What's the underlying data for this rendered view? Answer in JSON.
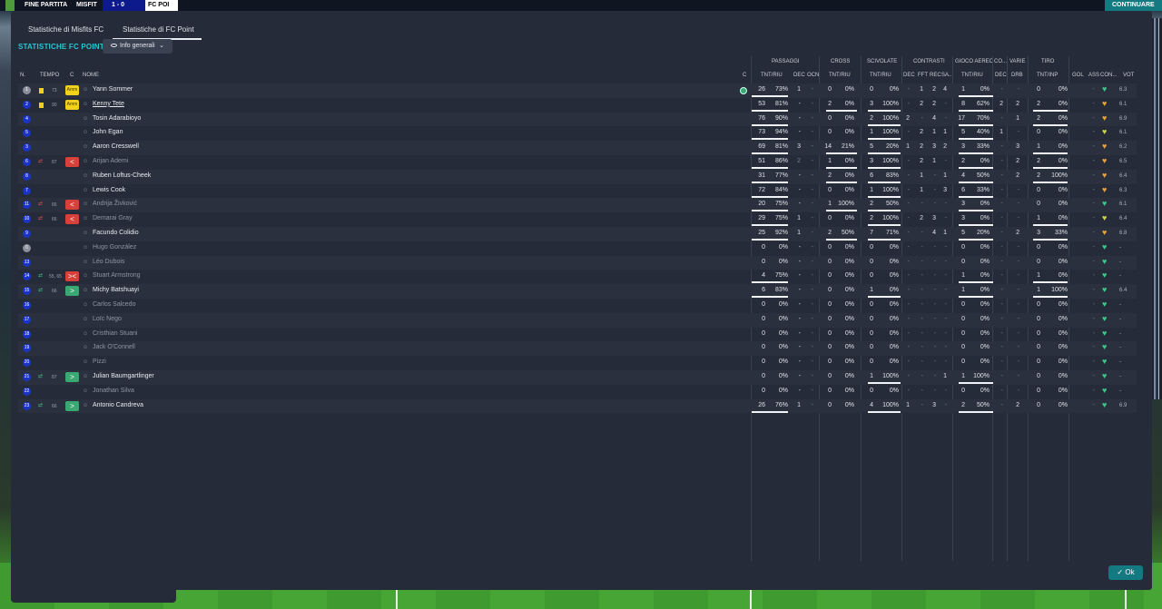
{
  "topbar": {
    "left_label": "FINE PARTITA",
    "home": "MISFIT",
    "away": "FC POI",
    "score": "1 - 0",
    "continue": "CONTINUARE"
  },
  "tabs": [
    {
      "label": "Statistiche di Misfits FC"
    },
    {
      "label": "Statistiche di FC Point"
    }
  ],
  "section_title": "STATISTICHE FC POINT",
  "view_select": {
    "value": "Info generali"
  },
  "groups": {
    "passaggi": "PASSAGGI",
    "cross": "CROSS",
    "scivolate": "SCIVOLATE",
    "contrasti": "CONTRASTI",
    "gioco_aereo": "GIOCO AEREO",
    "co": "CO...",
    "varie": "VARIE",
    "tiro": "TIRO"
  },
  "columns": {
    "n": "N.",
    "tempo": "TEMPO",
    "c": "C",
    "nome": "NOME",
    "c2": "C",
    "tnt_riu": "TNT/RIU",
    "dec": "DEC",
    "ocn": "OCN",
    "tnt_riu2": "TNT/RIU",
    "tnt_riu3": "TNT/RIU",
    "dec2": "DEC",
    "fft": "FFT",
    "rec": "REC",
    "sa": "SA...",
    "tnt_riu4": "TNT/RIU",
    "dec3": "DEC",
    "drb": "DRB",
    "tnt_inp": "TNT/INP",
    "gol": "GOL",
    "ass": "ASS",
    "con": "CON...",
    "vot": "VOT"
  },
  "players": [
    {
      "n": "1",
      "gk": true,
      "card": true,
      "time": "73",
      "c": "amm",
      "name": "Yann Sommer",
      "check": true,
      "pa": "26",
      "pp": "73%",
      "pdec": "1",
      "pocn": "-",
      "ca": "0",
      "cp": "0%",
      "sa": "0",
      "sp": "0%",
      "cd": "-",
      "cf": "1",
      "cr": "2",
      "cs": "4",
      "ga": "1",
      "gp": "0%",
      "co": "-",
      "vd": "-",
      "ta": "0",
      "tp": "0%",
      "gol": "",
      "ass": "-",
      "heart": "g",
      "vot": "6.3"
    },
    {
      "n": "2",
      "card": true,
      "time": "90",
      "c": "amm",
      "name": "Kenny Tete",
      "link": true,
      "pa": "53",
      "pp": "81%",
      "pdec": "-",
      "pocn": "-",
      "ca": "2",
      "cp": "0%",
      "sa": "3",
      "sp": "100%",
      "cd": "-",
      "cf": "2",
      "cr": "2",
      "cs": "-",
      "ga": "8",
      "gp": "62%",
      "co": "2",
      "vd": "2",
      "ta": "2",
      "tp": "0%",
      "gol": "",
      "ass": "-",
      "heart": "o",
      "vot": "6.1"
    },
    {
      "n": "4",
      "name": "Tosin Adarabioyo",
      "pa": "76",
      "pp": "90%",
      "pdec": "-",
      "pocn": "-",
      "ca": "0",
      "cp": "0%",
      "sa": "2",
      "sp": "100%",
      "cd": "2",
      "cf": "-",
      "cr": "4",
      "cs": "-",
      "ga": "17",
      "gp": "70%",
      "co": "-",
      "vd": "1",
      "ta": "2",
      "tp": "0%",
      "gol": "",
      "ass": "-",
      "heart": "o",
      "vot": "6.9"
    },
    {
      "n": "5",
      "name": "John Egan",
      "pa": "73",
      "pp": "94%",
      "pdec": "-",
      "pocn": "-",
      "ca": "0",
      "cp": "0%",
      "sa": "1",
      "sp": "100%",
      "cd": "-",
      "cf": "2",
      "cr": "1",
      "cs": "1",
      "ga": "5",
      "gp": "40%",
      "co": "1",
      "vd": "-",
      "ta": "0",
      "tp": "0%",
      "gol": "",
      "ass": "-",
      "heart": "y",
      "vot": "6.1"
    },
    {
      "n": "3",
      "name": "Aaron Cresswell",
      "pa": "69",
      "pp": "81%",
      "pdec": "3",
      "pocn": "-",
      "ca": "14",
      "cp": "21%",
      "sa": "5",
      "sp": "20%",
      "cd": "1",
      "cf": "2",
      "cr": "3",
      "cs": "2",
      "ga": "3",
      "gp": "33%",
      "co": "-",
      "vd": "3",
      "ta": "1",
      "tp": "0%",
      "gol": "",
      "ass": "-",
      "heart": "o",
      "vot": "6.2"
    },
    {
      "n": "6",
      "sub": "out",
      "time": "87",
      "c": "out",
      "name": "Arijan Ademi",
      "dim": true,
      "pa": "51",
      "pp": "86%",
      "pdec": "2",
      "pocn": "-",
      "ca": "1",
      "cp": "0%",
      "sa": "3",
      "sp": "100%",
      "cd": "-",
      "cf": "2",
      "cr": "1",
      "cs": "-",
      "ga": "2",
      "gp": "0%",
      "co": "-",
      "vd": "2",
      "ta": "2",
      "tp": "0%",
      "gol": "",
      "ass": "-",
      "heart": "o",
      "vot": "6.5"
    },
    {
      "n": "8",
      "name": "Ruben Loftus-Cheek",
      "pa": "31",
      "pp": "77%",
      "pdec": "-",
      "pocn": "-",
      "ca": "2",
      "cp": "0%",
      "sa": "6",
      "sp": "83%",
      "cd": "-",
      "cf": "1",
      "cr": "-",
      "cs": "1",
      "ga": "4",
      "gp": "50%",
      "co": "-",
      "vd": "2",
      "ta": "2",
      "tp": "100%",
      "gol": "",
      "ass": "-",
      "heart": "o",
      "vot": "6.4"
    },
    {
      "n": "7",
      "name": "Lewis Cook",
      "pa": "72",
      "pp": "84%",
      "pdec": "-",
      "pocn": "-",
      "ca": "0",
      "cp": "0%",
      "sa": "1",
      "sp": "100%",
      "cd": "-",
      "cf": "1",
      "cr": "-",
      "cs": "3",
      "ga": "6",
      "gp": "33%",
      "co": "-",
      "vd": "-",
      "ta": "0",
      "tp": "0%",
      "gol": "",
      "ass": "-",
      "heart": "o",
      "vot": "6.3"
    },
    {
      "n": "11",
      "sub": "out",
      "time": "66",
      "c": "out",
      "name": "Andrija Živković",
      "dim": true,
      "pa": "20",
      "pp": "75%",
      "pdec": "-",
      "pocn": "-",
      "ca": "1",
      "cp": "100%",
      "sa": "2",
      "sp": "50%",
      "cd": "-",
      "cf": "-",
      "cr": "-",
      "cs": "-",
      "ga": "3",
      "gp": "0%",
      "co": "-",
      "vd": "-",
      "ta": "0",
      "tp": "0%",
      "gol": "",
      "ass": "-",
      "heart": "g",
      "vot": "6.1"
    },
    {
      "n": "10",
      "sub": "out",
      "time": "66",
      "c": "out",
      "name": "Demarai Gray",
      "dim": true,
      "pa": "29",
      "pp": "75%",
      "pdec": "1",
      "pocn": "-",
      "ca": "0",
      "cp": "0%",
      "sa": "2",
      "sp": "100%",
      "cd": "-",
      "cf": "2",
      "cr": "3",
      "cs": "-",
      "ga": "3",
      "gp": "0%",
      "co": "-",
      "vd": "-",
      "ta": "1",
      "tp": "0%",
      "gol": "",
      "ass": "-",
      "heart": "y",
      "vot": "6.4"
    },
    {
      "n": "9",
      "name": "Facundo Colidio",
      "pa": "25",
      "pp": "92%",
      "pdec": "1",
      "pocn": "-",
      "ca": "2",
      "cp": "50%",
      "sa": "7",
      "sp": "71%",
      "cd": "-",
      "cf": "-",
      "cr": "4",
      "cs": "1",
      "ga": "5",
      "gp": "20%",
      "co": "-",
      "vd": "2",
      "ta": "3",
      "tp": "33%",
      "gol": "",
      "ass": "-",
      "heart": "o",
      "vot": "6.8"
    },
    {
      "n": "0",
      "gk": true,
      "name": "Hugo González",
      "dim": true,
      "pa": "0",
      "pp": "0%",
      "pdec": "-",
      "pocn": "-",
      "ca": "0",
      "cp": "0%",
      "sa": "0",
      "sp": "0%",
      "cd": "-",
      "cf": "-",
      "cr": "-",
      "cs": "-",
      "ga": "0",
      "gp": "0%",
      "co": "-",
      "vd": "-",
      "ta": "0",
      "tp": "0%",
      "gol": "",
      "ass": "-",
      "heart": "g",
      "vot": "-"
    },
    {
      "n": "13",
      "name": "Léo Dubois",
      "dim": true,
      "pa": "0",
      "pp": "0%",
      "pdec": "-",
      "pocn": "-",
      "ca": "0",
      "cp": "0%",
      "sa": "0",
      "sp": "0%",
      "cd": "-",
      "cf": "-",
      "cr": "-",
      "cs": "-",
      "ga": "0",
      "gp": "0%",
      "co": "-",
      "vd": "-",
      "ta": "0",
      "tp": "0%",
      "gol": "",
      "ass": "-",
      "heart": "g",
      "vot": "-"
    },
    {
      "n": "14",
      "sub": "inout",
      "time": "55, 65",
      "c": "both",
      "name": "Stuart Armstrong",
      "dim": true,
      "pa": "4",
      "pp": "75%",
      "pdec": "-",
      "pocn": "-",
      "ca": "0",
      "cp": "0%",
      "sa": "0",
      "sp": "0%",
      "cd": "-",
      "cf": "-",
      "cr": "-",
      "cs": "-",
      "ga": "1",
      "gp": "0%",
      "co": "-",
      "vd": "-",
      "ta": "1",
      "tp": "0%",
      "gol": "",
      "ass": "-",
      "heart": "g",
      "vot": "-"
    },
    {
      "n": "15",
      "sub": "in",
      "time": "66",
      "c": "in",
      "name": "Michy Batshuayi",
      "pa": "6",
      "pp": "83%",
      "pdec": "-",
      "pocn": "-",
      "ca": "0",
      "cp": "0%",
      "sa": "1",
      "sp": "0%",
      "cd": "-",
      "cf": "-",
      "cr": "-",
      "cs": "-",
      "ga": "1",
      "gp": "0%",
      "co": "-",
      "vd": "-",
      "ta": "1",
      "tp": "100%",
      "gol": "",
      "ass": "-",
      "heart": "g",
      "vot": "6.4"
    },
    {
      "n": "16",
      "name": "Carlos Salcedo",
      "dim": true,
      "pa": "0",
      "pp": "0%",
      "pdec": "-",
      "pocn": "-",
      "ca": "0",
      "cp": "0%",
      "sa": "0",
      "sp": "0%",
      "cd": "-",
      "cf": "-",
      "cr": "-",
      "cs": "-",
      "ga": "0",
      "gp": "0%",
      "co": "-",
      "vd": "-",
      "ta": "0",
      "tp": "0%",
      "gol": "",
      "ass": "-",
      "heart": "g",
      "vot": "-"
    },
    {
      "n": "17",
      "name": "Loïc Nego",
      "dim": true,
      "pa": "0",
      "pp": "0%",
      "pdec": "-",
      "pocn": "-",
      "ca": "0",
      "cp": "0%",
      "sa": "0",
      "sp": "0%",
      "cd": "-",
      "cf": "-",
      "cr": "-",
      "cs": "-",
      "ga": "0",
      "gp": "0%",
      "co": "-",
      "vd": "-",
      "ta": "0",
      "tp": "0%",
      "gol": "",
      "ass": "-",
      "heart": "g",
      "vot": "-"
    },
    {
      "n": "18",
      "name": "Cristhian Stuani",
      "dim": true,
      "pa": "0",
      "pp": "0%",
      "pdec": "-",
      "pocn": "-",
      "ca": "0",
      "cp": "0%",
      "sa": "0",
      "sp": "0%",
      "cd": "-",
      "cf": "-",
      "cr": "-",
      "cs": "-",
      "ga": "0",
      "gp": "0%",
      "co": "-",
      "vd": "-",
      "ta": "0",
      "tp": "0%",
      "gol": "",
      "ass": "-",
      "heart": "g",
      "vot": "-"
    },
    {
      "n": "19",
      "name": "Jack O'Connell",
      "dim": true,
      "pa": "0",
      "pp": "0%",
      "pdec": "-",
      "pocn": "-",
      "ca": "0",
      "cp": "0%",
      "sa": "0",
      "sp": "0%",
      "cd": "-",
      "cf": "-",
      "cr": "-",
      "cs": "-",
      "ga": "0",
      "gp": "0%",
      "co": "-",
      "vd": "-",
      "ta": "0",
      "tp": "0%",
      "gol": "",
      "ass": "-",
      "heart": "g",
      "vot": "-"
    },
    {
      "n": "20",
      "name": "Pizzi",
      "dim": true,
      "pa": "0",
      "pp": "0%",
      "pdec": "-",
      "pocn": "-",
      "ca": "0",
      "cp": "0%",
      "sa": "0",
      "sp": "0%",
      "cd": "-",
      "cf": "-",
      "cr": "-",
      "cs": "-",
      "ga": "0",
      "gp": "0%",
      "co": "-",
      "vd": "-",
      "ta": "0",
      "tp": "0%",
      "gol": "",
      "ass": "-",
      "heart": "g",
      "vot": "-"
    },
    {
      "n": "21",
      "sub": "in",
      "time": "87",
      "c": "in",
      "name": "Julian Baumgartlinger",
      "pa": "0",
      "pp": "0%",
      "pdec": "-",
      "pocn": "-",
      "ca": "0",
      "cp": "0%",
      "sa": "1",
      "sp": "100%",
      "cd": "-",
      "cf": "-",
      "cr": "-",
      "cs": "1",
      "ga": "1",
      "gp": "100%",
      "co": "-",
      "vd": "-",
      "ta": "0",
      "tp": "0%",
      "gol": "",
      "ass": "-",
      "heart": "g",
      "vot": "-"
    },
    {
      "n": "22",
      "name": "Jonathan Silva",
      "dim": true,
      "pa": "0",
      "pp": "0%",
      "pdec": "-",
      "pocn": "-",
      "ca": "0",
      "cp": "0%",
      "sa": "0",
      "sp": "0%",
      "cd": "-",
      "cf": "-",
      "cr": "-",
      "cs": "-",
      "ga": "0",
      "gp": "0%",
      "co": "-",
      "vd": "-",
      "ta": "0",
      "tp": "0%",
      "gol": "",
      "ass": "-",
      "heart": "g",
      "vot": "-"
    },
    {
      "n": "23",
      "sub": "in",
      "time": "66",
      "c": "in",
      "name": "Antonio Candreva",
      "pa": "26",
      "pp": "76%",
      "pdec": "1",
      "pocn": "-",
      "ca": "0",
      "cp": "0%",
      "sa": "4",
      "sp": "100%",
      "cd": "1",
      "cf": "-",
      "cr": "3",
      "cs": "-",
      "ga": "2",
      "gp": "50%",
      "co": "-",
      "vd": "2",
      "ta": "0",
      "tp": "0%",
      "gol": "",
      "ass": "-",
      "heart": "g",
      "vot": "6.9"
    }
  ],
  "ok_label": "Ok"
}
